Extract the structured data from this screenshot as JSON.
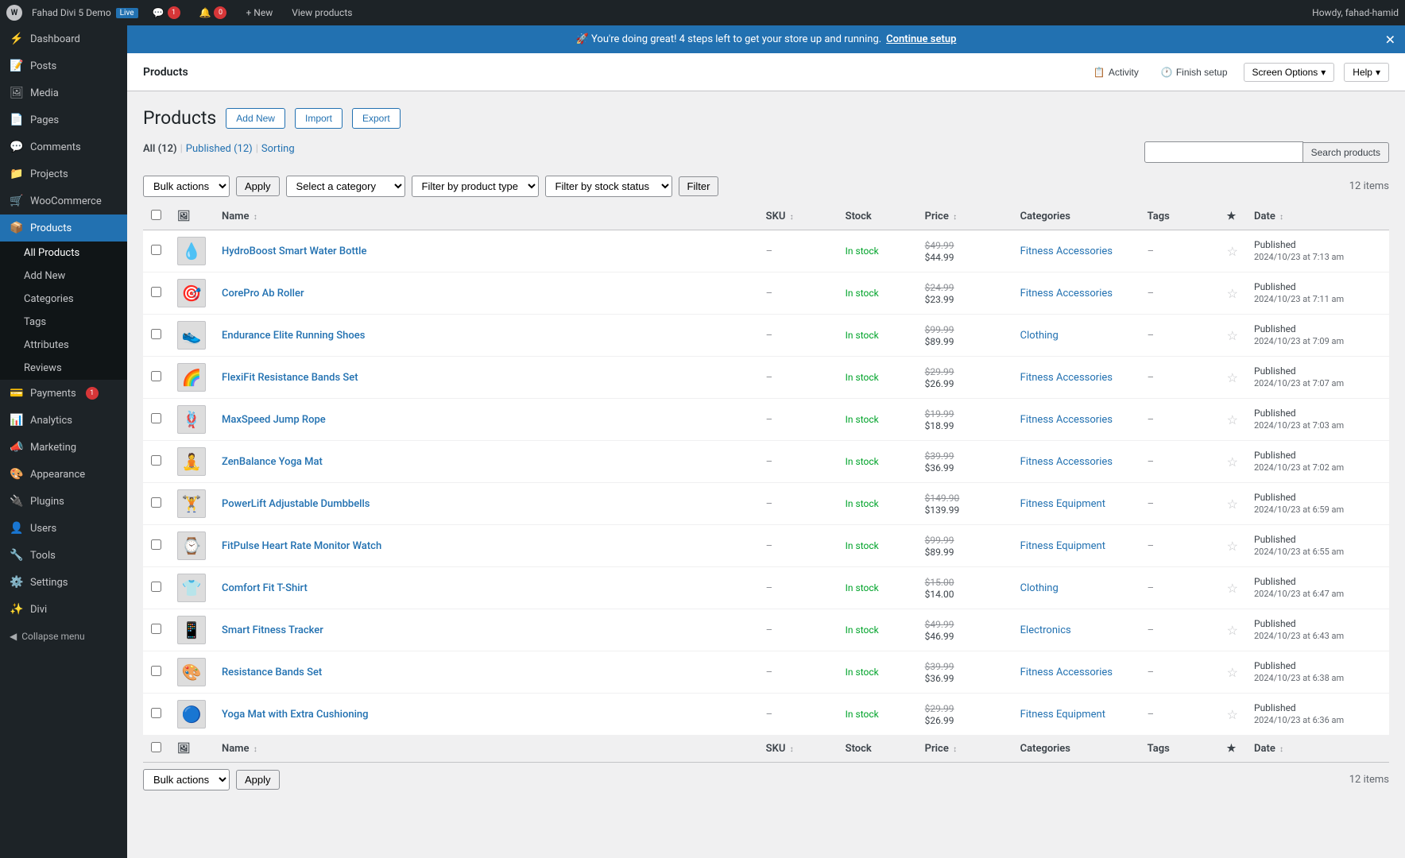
{
  "adminBar": {
    "siteName": "Fahad Divi 5 Demo",
    "liveBadge": "Live",
    "commentCount": "1",
    "updateCount": "0",
    "newLabel": "+ New",
    "viewProductsLabel": "View products",
    "userLabel": "Howdy, fahad-hamid"
  },
  "setupBanner": {
    "text": "🚀 You're doing great! 4 steps left to get your store up and running.",
    "linkText": "Continue setup"
  },
  "pageHeader": {
    "title": "Products",
    "activityLabel": "Activity",
    "finishSetupLabel": "Finish setup",
    "screenOptionsLabel": "Screen Options",
    "helpLabel": "Help"
  },
  "sidebar": {
    "items": [
      {
        "id": "dashboard",
        "label": "Dashboard",
        "icon": "⚡"
      },
      {
        "id": "posts",
        "label": "Posts",
        "icon": "📝"
      },
      {
        "id": "media",
        "label": "Media",
        "icon": "🖼"
      },
      {
        "id": "pages",
        "label": "Pages",
        "icon": "📄"
      },
      {
        "id": "comments",
        "label": "Comments",
        "icon": "💬"
      },
      {
        "id": "projects",
        "label": "Projects",
        "icon": "📁"
      },
      {
        "id": "woocommerce",
        "label": "WooCommerce",
        "icon": "🛒"
      },
      {
        "id": "products",
        "label": "Products",
        "icon": "📦",
        "active": true
      },
      {
        "id": "payments",
        "label": "Payments",
        "icon": "💳",
        "notif": "1"
      },
      {
        "id": "analytics",
        "label": "Analytics",
        "icon": "📊"
      },
      {
        "id": "marketing",
        "label": "Marketing",
        "icon": "📣"
      },
      {
        "id": "appearance",
        "label": "Appearance",
        "icon": "🎨"
      },
      {
        "id": "plugins",
        "label": "Plugins",
        "icon": "🔌"
      },
      {
        "id": "users",
        "label": "Users",
        "icon": "👤"
      },
      {
        "id": "tools",
        "label": "Tools",
        "icon": "🔧"
      },
      {
        "id": "settings",
        "label": "Settings",
        "icon": "⚙️"
      },
      {
        "id": "divi",
        "label": "Divi",
        "icon": "✨"
      }
    ],
    "subItems": [
      {
        "id": "all-products",
        "label": "All Products",
        "active": true
      },
      {
        "id": "add-new",
        "label": "Add New"
      },
      {
        "id": "categories",
        "label": "Categories"
      },
      {
        "id": "tags",
        "label": "Tags"
      },
      {
        "id": "attributes",
        "label": "Attributes"
      },
      {
        "id": "reviews",
        "label": "Reviews"
      }
    ],
    "collapseLabel": "Collapse menu"
  },
  "productsPage": {
    "title": "Products",
    "buttons": {
      "addNew": "Add New",
      "import": "Import",
      "export": "Export"
    },
    "filterTabs": [
      {
        "id": "all",
        "label": "All",
        "count": "12",
        "active": true
      },
      {
        "id": "published",
        "label": "Published",
        "count": "12"
      },
      {
        "id": "sorting",
        "label": "Sorting"
      }
    ],
    "search": {
      "placeholder": "",
      "buttonLabel": "Search products"
    },
    "filters": {
      "bulkActions": "Bulk actions",
      "applyLabel": "Apply",
      "categoryPlaceholder": "Select a category",
      "productTypePlaceholder": "Filter by product type",
      "stockStatusPlaceholder": "Filter by stock status",
      "filterLabel": "Filter"
    },
    "itemCount": "12 items",
    "table": {
      "headers": {
        "name": "Name",
        "sku": "SKU",
        "stock": "Stock",
        "price": "Price",
        "categories": "Categories",
        "tags": "Tags",
        "date": "Date"
      },
      "products": [
        {
          "id": 1,
          "name": "HydroBoost Smart Water Bottle",
          "sku": "–",
          "stock": "In stock",
          "priceOriginal": "$49.99",
          "priceSale": "$44.99",
          "categories": "Fitness Accessories",
          "tags": "–",
          "published": "Published",
          "date": "2024/10/23 at 7:13 am",
          "emoji": "💧"
        },
        {
          "id": 2,
          "name": "CorePro Ab Roller",
          "sku": "–",
          "stock": "In stock",
          "priceOriginal": "$24.99",
          "priceSale": "$23.99",
          "categories": "Fitness Accessories",
          "tags": "–",
          "published": "Published",
          "date": "2024/10/23 at 7:11 am",
          "emoji": "🎯"
        },
        {
          "id": 3,
          "name": "Endurance Elite Running Shoes",
          "sku": "–",
          "stock": "In stock",
          "priceOriginal": "$99.99",
          "priceSale": "$89.99",
          "categories": "Clothing",
          "tags": "–",
          "published": "Published",
          "date": "2024/10/23 at 7:09 am",
          "emoji": "👟"
        },
        {
          "id": 4,
          "name": "FlexiFit Resistance Bands Set",
          "sku": "–",
          "stock": "In stock",
          "priceOriginal": "$29.99",
          "priceSale": "$26.99",
          "categories": "Fitness Accessories",
          "tags": "–",
          "published": "Published",
          "date": "2024/10/23 at 7:07 am",
          "emoji": "🌈"
        },
        {
          "id": 5,
          "name": "MaxSpeed Jump Rope",
          "sku": "–",
          "stock": "In stock",
          "priceOriginal": "$19.99",
          "priceSale": "$18.99",
          "categories": "Fitness Accessories",
          "tags": "–",
          "published": "Published",
          "date": "2024/10/23 at 7:03 am",
          "emoji": "🪢"
        },
        {
          "id": 6,
          "name": "ZenBalance Yoga Mat",
          "sku": "–",
          "stock": "In stock",
          "priceOriginal": "$39.99",
          "priceSale": "$36.99",
          "categories": "Fitness Accessories",
          "tags": "–",
          "published": "Published",
          "date": "2024/10/23 at 7:02 am",
          "emoji": "🧘"
        },
        {
          "id": 7,
          "name": "PowerLift Adjustable Dumbbells",
          "sku": "–",
          "stock": "In stock",
          "priceOriginal": "$149.90",
          "priceSale": "$139.99",
          "categories": "Fitness Equipment",
          "tags": "–",
          "published": "Published",
          "date": "2024/10/23 at 6:59 am",
          "emoji": "🏋️"
        },
        {
          "id": 8,
          "name": "FitPulse Heart Rate Monitor Watch",
          "sku": "–",
          "stock": "In stock",
          "priceOriginal": "$99.99",
          "priceSale": "$89.99",
          "categories": "Fitness Equipment",
          "tags": "–",
          "published": "Published",
          "date": "2024/10/23 at 6:55 am",
          "emoji": "⌚"
        },
        {
          "id": 9,
          "name": "Comfort Fit T-Shirt",
          "sku": "–",
          "stock": "In stock",
          "priceOriginal": "$15.00",
          "priceSale": "$14.00",
          "categories": "Clothing",
          "tags": "–",
          "published": "Published",
          "date": "2024/10/23 at 6:47 am",
          "emoji": "👕"
        },
        {
          "id": 10,
          "name": "Smart Fitness Tracker",
          "sku": "–",
          "stock": "In stock",
          "priceOriginal": "$49.99",
          "priceSale": "$46.99",
          "categories": "Electronics",
          "tags": "–",
          "published": "Published",
          "date": "2024/10/23 at 6:43 am",
          "emoji": "📱"
        },
        {
          "id": 11,
          "name": "Resistance Bands Set",
          "sku": "–",
          "stock": "In stock",
          "priceOriginal": "$39.99",
          "priceSale": "$36.99",
          "categories": "Fitness Accessories",
          "tags": "–",
          "published": "Published",
          "date": "2024/10/23 at 6:38 am",
          "emoji": "🎨"
        },
        {
          "id": 12,
          "name": "Yoga Mat with Extra Cushioning",
          "sku": "–",
          "stock": "In stock",
          "priceOriginal": "$29.99",
          "priceSale": "$26.99",
          "categories": "Fitness Equipment",
          "tags": "–",
          "published": "Published",
          "date": "2024/10/23 at 6:36 am",
          "emoji": "🔵"
        }
      ]
    },
    "bottomActions": {
      "bulkActionsLabel": "Bulk actions",
      "applyLabel": "Apply"
    },
    "itemCountBottom": "12 items"
  }
}
